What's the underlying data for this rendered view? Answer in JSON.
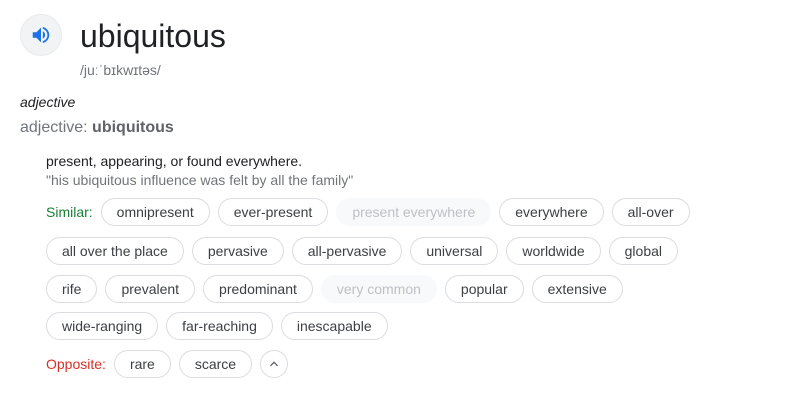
{
  "entry": {
    "word": "ubiquitous",
    "pronunciation": "/juːˈbɪkwɪtəs/",
    "part_of_speech": "adjective",
    "pos_prefix": "adjective: ",
    "pos_word": "ubiquitous",
    "speaker_icon": "volume-up-icon",
    "accent_color": "#1a73e8"
  },
  "sense": {
    "definition": "present, appearing, or found everywhere.",
    "example": "\"his ubiquitous influence was felt by all the family\""
  },
  "similar": {
    "label": "Similar:",
    "label_color": "#188038",
    "rows": [
      [
        {
          "text": "omnipresent",
          "disabled": false
        },
        {
          "text": "ever-present",
          "disabled": false
        },
        {
          "text": "present everywhere",
          "disabled": true
        },
        {
          "text": "everywhere",
          "disabled": false
        },
        {
          "text": "all-over",
          "disabled": false
        }
      ],
      [
        {
          "text": "all over the place",
          "disabled": false
        },
        {
          "text": "pervasive",
          "disabled": false
        },
        {
          "text": "all-pervasive",
          "disabled": false
        },
        {
          "text": "universal",
          "disabled": false
        },
        {
          "text": "worldwide",
          "disabled": false
        },
        {
          "text": "global",
          "disabled": false
        }
      ],
      [
        {
          "text": "rife",
          "disabled": false
        },
        {
          "text": "prevalent",
          "disabled": false
        },
        {
          "text": "predominant",
          "disabled": false
        },
        {
          "text": "very common",
          "disabled": true
        },
        {
          "text": "popular",
          "disabled": false
        },
        {
          "text": "extensive",
          "disabled": false
        }
      ],
      [
        {
          "text": "wide-ranging",
          "disabled": false
        },
        {
          "text": "far-reaching",
          "disabled": false
        },
        {
          "text": "inescapable",
          "disabled": false
        }
      ]
    ]
  },
  "opposite": {
    "label": "Opposite:",
    "label_color": "#d93025",
    "chips": [
      {
        "text": "rare",
        "disabled": false
      },
      {
        "text": "scarce",
        "disabled": false
      }
    ],
    "expand_icon": "chevron-up-icon"
  }
}
